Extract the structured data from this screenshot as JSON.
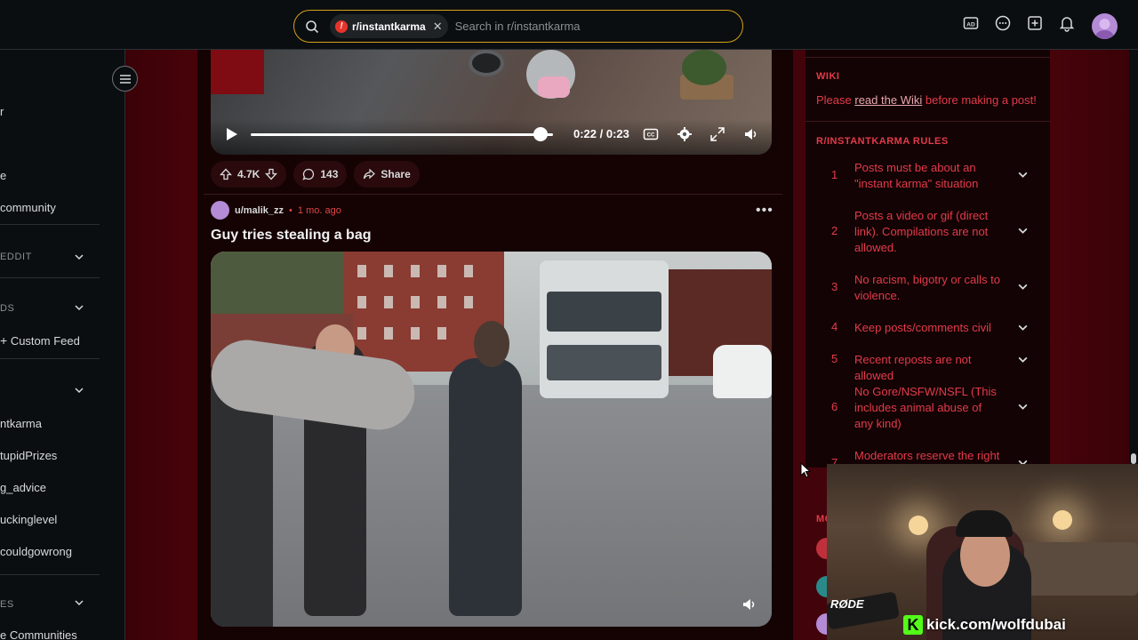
{
  "search": {
    "chip_label": "r/instantkarma",
    "placeholder": "Search in r/instantkarma"
  },
  "top_icons": [
    "advertise-icon",
    "chat-icon",
    "create-post-icon",
    "notification-bell-icon"
  ],
  "sidebar": {
    "items_top": [
      {
        "label": "r"
      },
      {
        "label": "e"
      },
      {
        "label": "community"
      }
    ],
    "section_reddit": "EDDIT",
    "section_feeds": "DS",
    "custom_feed": "Custom Feed",
    "communities": [
      "ntkarma",
      "tupidPrizes",
      "g_advice",
      "uckinglevel",
      "couldgowrong"
    ],
    "section_resources": "ES",
    "more_communities": "e Communities"
  },
  "prev_post": {
    "time": "0:22 / 0:23",
    "progress": 0.96,
    "votes": "4.7K",
    "comments": "143",
    "share": "Share"
  },
  "post": {
    "user": "u/malik_zz",
    "separator": "•",
    "time": "1 mo. ago",
    "title": "Guy tries stealing a bag"
  },
  "right_sidebar": {
    "wiki_head": "WIKI",
    "wiki_pre": "Please ",
    "wiki_link": "read the Wiki",
    "wiki_post": " before making a post!",
    "rules_head": "R/INSTANTKARMA RULES",
    "rules": [
      {
        "num": "1",
        "text": "Posts must be about an \"instant karma\" situation"
      },
      {
        "num": "2",
        "text": "Posts a video or gif (direct link). Compilations are not allowed."
      },
      {
        "num": "3",
        "text": "No racism, bigotry or calls to violence."
      },
      {
        "num": "4",
        "text": "Keep posts/comments civil"
      },
      {
        "num": "5",
        "text": "Recent reposts are not allowed"
      },
      {
        "num": "6",
        "text": "No Gore/NSFW/NSFL (This includes animal abuse of any kind)"
      },
      {
        "num": "7",
        "text": "Moderators reserve the right"
      }
    ],
    "mods_head_partial": "MC"
  },
  "webcam": {
    "mic_brand": "RØDE",
    "kick_url": "kick.com/wolfdubai"
  },
  "colors": {
    "accent_red": "#e23b4a",
    "search_border": "#d4a017",
    "kick_green": "#53fc18"
  }
}
